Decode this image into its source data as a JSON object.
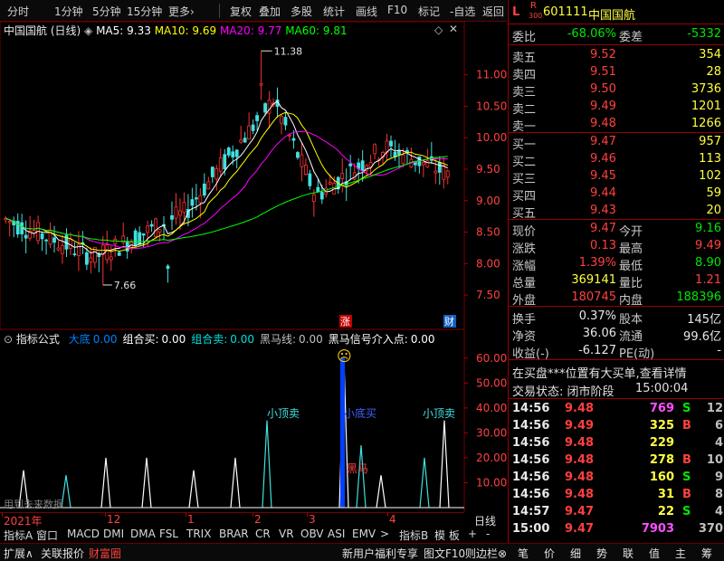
{
  "toolbar": {
    "items": [
      "分时",
      "1分钟",
      "5分钟",
      "15分钟",
      "更多›",
      "复权",
      "叠加",
      "多股",
      "统计",
      "画线",
      "F10",
      "标记",
      "-自选",
      "返回"
    ]
  },
  "main_chart": {
    "title": "中国国航 (日线)",
    "ma": [
      {
        "label": "MA5: 9.33",
        "color": "#ffffff"
      },
      {
        "label": "MA10: 9.69",
        "color": "#ffff00"
      },
      {
        "label": "MA20: 9.77",
        "color": "#ff00ff"
      },
      {
        "label": "MA60: 9.81",
        "color": "#00ff00"
      }
    ],
    "high_label": "11.38",
    "low_label": "7.66",
    "y_ticks": [
      "11.00",
      "10.50",
      "10.00",
      "9.50",
      "9.00",
      "8.50",
      "8.00",
      "7.50"
    ],
    "badge_up": "涨",
    "badge_fin": "财"
  },
  "indicator": {
    "title": "指标公式",
    "items": [
      {
        "label": "大底",
        "value": "0.00",
        "color": "#0080ff"
      },
      {
        "label": "组合买:",
        "value": "0.00",
        "color": "#ffffff"
      },
      {
        "label": "组合卖:",
        "value": "0.00",
        "color": "#00e0e0"
      },
      {
        "label": "黑马线:",
        "value": "0.00",
        "color": "#c0c0c0"
      },
      {
        "label": "黑马信号介入点:",
        "value": "0.00",
        "color": "#ffffff"
      }
    ],
    "y_ticks": [
      "60.00",
      "50.00",
      "40.00",
      "30.00",
      "20.00",
      "10.00"
    ],
    "annotations": [
      "小顶卖",
      "小底买",
      "小顶卖",
      "黑马"
    ],
    "watermark": "用到未来数据",
    "emoji": "☹"
  },
  "time_axis": {
    "labels": [
      "2021年",
      "12",
      "1",
      "2",
      "3",
      "4"
    ],
    "period": "日线"
  },
  "indicator_tabs": [
    "指标A",
    "窗口",
    "MACD",
    "DMI",
    "DMA",
    "FSL",
    "TRIX",
    "BRAR",
    "CR",
    "VR",
    "OBV",
    "ASI",
    "EMV",
    ">",
    "指标B",
    "模 板",
    "+",
    "-"
  ],
  "stock": {
    "badge_l": "L",
    "badge_r": "R",
    "badge_num": "300",
    "code": "601111",
    "name": "中国国航"
  },
  "weibi": {
    "label1": "委比",
    "value1": "-68.06%",
    "label2": "委差",
    "value2": "-5332"
  },
  "asks": [
    {
      "label": "卖五",
      "price": "9.52",
      "vol": "354"
    },
    {
      "label": "卖四",
      "price": "9.51",
      "vol": "28"
    },
    {
      "label": "卖三",
      "price": "9.50",
      "vol": "3736"
    },
    {
      "label": "卖二",
      "price": "9.49",
      "vol": "1201"
    },
    {
      "label": "卖一",
      "price": "9.48",
      "vol": "1266"
    }
  ],
  "bids": [
    {
      "label": "买一",
      "price": "9.47",
      "vol": "957"
    },
    {
      "label": "买二",
      "price": "9.46",
      "vol": "113"
    },
    {
      "label": "买三",
      "price": "9.45",
      "vol": "102"
    },
    {
      "label": "买四",
      "price": "9.44",
      "vol": "59"
    },
    {
      "label": "买五",
      "price": "9.43",
      "vol": "20"
    }
  ],
  "quote": [
    {
      "l1": "现价",
      "v1": "9.47",
      "c1": "#ff4040",
      "l2": "今开",
      "v2": "9.16",
      "c2": "#00e600"
    },
    {
      "l1": "涨跌",
      "v1": "0.13",
      "c1": "#ff4040",
      "l2": "最高",
      "v2": "9.49",
      "c2": "#ff4040"
    },
    {
      "l1": "涨幅",
      "v1": "1.39%",
      "c1": "#ff4040",
      "l2": "最低",
      "v2": "8.90",
      "c2": "#00e600"
    },
    {
      "l1": "总量",
      "v1": "369141",
      "c1": "#ffff40",
      "l2": "量比",
      "v2": "1.21",
      "c2": "#ff4040"
    },
    {
      "l1": "外盘",
      "v1": "180745",
      "c1": "#ff4040",
      "l2": "内盘",
      "v2": "188396",
      "c2": "#00e600"
    }
  ],
  "fin": [
    {
      "l1": "换手",
      "v1": "0.37%",
      "l2": "股本",
      "v2": "145亿"
    },
    {
      "l1": "净资",
      "v1": "36.06",
      "l2": "流通",
      "v2": "99.6亿"
    },
    {
      "l1": "收益(-)",
      "v1": "-6.127",
      "l2": "PE(动)",
      "v2": "-"
    }
  ],
  "notice": "在买盘***位置有大买单,查看详情",
  "trade_status": {
    "label": "交易状态: 闭市阶段",
    "time": "15:00:04"
  },
  "ticks": [
    {
      "time": "14:56",
      "price": "9.48",
      "vol": "769",
      "vc": "#ff50ff",
      "side": "S",
      "sc": "#00e600",
      "n": "12"
    },
    {
      "time": "14:56",
      "price": "9.49",
      "vol": "325",
      "vc": "#ffff40",
      "side": "B",
      "sc": "#ff4040",
      "n": "6"
    },
    {
      "time": "14:56",
      "price": "9.48",
      "vol": "229",
      "vc": "#ffff40",
      "side": "",
      "sc": "#ffffff",
      "n": "4"
    },
    {
      "time": "14:56",
      "price": "9.48",
      "vol": "278",
      "vc": "#ffff40",
      "side": "B",
      "sc": "#ff4040",
      "n": "10"
    },
    {
      "time": "14:56",
      "price": "9.48",
      "vol": "160",
      "vc": "#ffff40",
      "side": "S",
      "sc": "#00e600",
      "n": "9"
    },
    {
      "time": "14:56",
      "price": "9.48",
      "vol": "31",
      "vc": "#ffff40",
      "side": "B",
      "sc": "#ff4040",
      "n": "8"
    },
    {
      "time": "14:57",
      "price": "9.47",
      "vol": "22",
      "vc": "#ffff40",
      "side": "S",
      "sc": "#00e600",
      "n": "4"
    },
    {
      "time": "15:00",
      "price": "9.47",
      "vol": "7903",
      "vc": "#ff50ff",
      "side": "",
      "sc": "#ffffff",
      "n": "370"
    }
  ],
  "bottom_bar": {
    "left": [
      "扩展∧",
      "关联报价",
      "财富圈"
    ],
    "right": [
      "新用户福利专享",
      "图文F10",
      "则边栏⊗"
    ],
    "panel_tabs": [
      "笔",
      "价",
      "细",
      "势",
      "联",
      "值",
      "主",
      "筹"
    ]
  },
  "chart_data": [
    {
      "type": "candlestick",
      "title": "中国国航 (日线)",
      "y_range": [
        7.3,
        11.7
      ],
      "high_point": 11.38,
      "low_point": 7.66,
      "series": [
        {
          "name": "MA5",
          "value": 9.33
        },
        {
          "name": "MA10",
          "value": 9.69
        },
        {
          "name": "MA20",
          "value": 9.77
        },
        {
          "name": "MA60",
          "value": 9.81
        }
      ]
    },
    {
      "type": "bar",
      "title": "指标公式",
      "y_range": [
        0,
        65
      ],
      "signals": [
        {
          "value": 15
        },
        {
          "value": 13
        },
        {
          "value": 20
        },
        {
          "value": 20
        },
        {
          "value": 15
        },
        {
          "value": 35
        },
        {
          "value": 60
        },
        {
          "value": 25
        },
        {
          "value": 13
        },
        {
          "value": 20
        },
        {
          "value": 35
        },
        {
          "value": 20
        }
      ]
    }
  ]
}
